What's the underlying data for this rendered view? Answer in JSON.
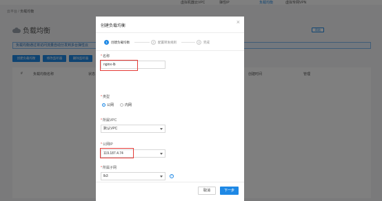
{
  "topnav": {
    "items": [
      "虚拟机器云VPC",
      "弹性IP",
      "负载均衡",
      "虚拟专网VPN"
    ]
  },
  "breadcrumb": {
    "root": "云平台",
    "sep": " / ",
    "current": "负载均衡"
  },
  "page": {
    "title": "负载均衡",
    "help": "帮助",
    "notice": "负载均衡通过将访问流量自动分发到多台弹性云",
    "actions": [
      "创建负载均衡",
      "修改监听器",
      "删除监听器"
    ],
    "columns": [
      "#",
      "负载均衡名称",
      "状态",
      "",
      "",
      "",
      "",
      "创建时间",
      "管理"
    ]
  },
  "dialog": {
    "title": "创建负载均衡",
    "close": "×",
    "steps": [
      {
        "num": "1",
        "label": "创建负载均衡",
        "state": "active"
      },
      {
        "num": "2",
        "label": "配置转发规则",
        "state": "inactive"
      },
      {
        "num": "3",
        "label": "完成",
        "state": "inactive"
      }
    ],
    "fields": {
      "name": {
        "label": "名称",
        "value": "nginx-lb"
      },
      "type": {
        "label": "类型",
        "options": [
          "公网",
          "内网"
        ],
        "selected": "公网"
      },
      "vpc": {
        "label": "所属VPC",
        "value": "默认VPC"
      },
      "public_ip": {
        "label": "公网IP",
        "value": "119.187.4.74"
      },
      "subnet": {
        "label": "所属子网",
        "value": "lb3"
      }
    },
    "buttons": {
      "cancel": "取消",
      "next": "下一步"
    }
  },
  "colors": {
    "primary": "#1e88e5",
    "required": "#e53935",
    "highlight_box": "#e53935"
  }
}
